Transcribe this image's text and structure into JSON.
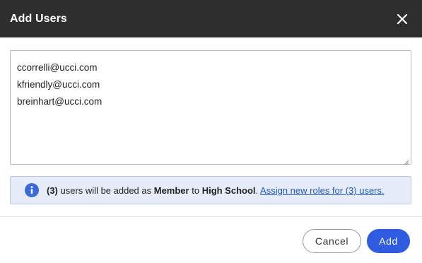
{
  "dialog": {
    "title": "Add Users",
    "close_icon": "close-icon"
  },
  "emails": [
    "ccorrelli@ucci.com",
    "kfriendly@ucci.com",
    "breinhart@ucci.com"
  ],
  "info": {
    "icon": "info-icon",
    "count": "(3)",
    "text1": " users will be added as ",
    "role": "Member",
    "text2": " to ",
    "group": "High School",
    "text3": ". ",
    "link": "Assign new roles for (3) users."
  },
  "footer": {
    "cancel_label": "Cancel",
    "add_label": "Add"
  },
  "colors": {
    "header_bg": "#2e2e2e",
    "primary": "#2f5be0",
    "info_bg": "#e6edf8",
    "link": "#2457c5"
  }
}
